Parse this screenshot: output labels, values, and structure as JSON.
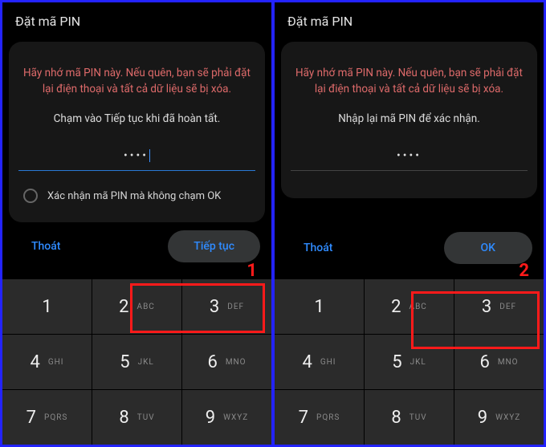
{
  "left": {
    "title": "Đặt mã PIN",
    "warning": "Hãy nhớ mã PIN này. Nếu quên, bạn sẽ phải đặt lại điện thoại và tất cả dữ liệu sẽ bị xóa.",
    "instruction": "Chạm vào Tiếp tục khi đã hoàn tất.",
    "pin": "••••",
    "confirm_label": "Xác nhận mã PIN mà không chạm OK",
    "step_badge": "1",
    "exit_label": "Thoát",
    "primary_label": "Tiếp tục"
  },
  "right": {
    "title": "Đặt mã PIN",
    "warning": "Hãy nhớ mã PIN này. Nếu quên, bạn sẽ phải đặt lại điện thoại và tất cả dữ liệu sẽ bị xóa.",
    "instruction": "Nhập lại mã PIN để xác nhận.",
    "pin": "••••",
    "step_badge": "2",
    "exit_label": "Thoát",
    "primary_label": "OK"
  },
  "keypad": [
    {
      "digit": "1",
      "letters": ""
    },
    {
      "digit": "2",
      "letters": "ABC"
    },
    {
      "digit": "3",
      "letters": "DEF"
    },
    {
      "digit": "4",
      "letters": "GHI"
    },
    {
      "digit": "5",
      "letters": "JKL"
    },
    {
      "digit": "6",
      "letters": "MNO"
    },
    {
      "digit": "7",
      "letters": "PQRS"
    },
    {
      "digit": "8",
      "letters": "TUV"
    },
    {
      "digit": "9",
      "letters": "WXYZ"
    }
  ]
}
